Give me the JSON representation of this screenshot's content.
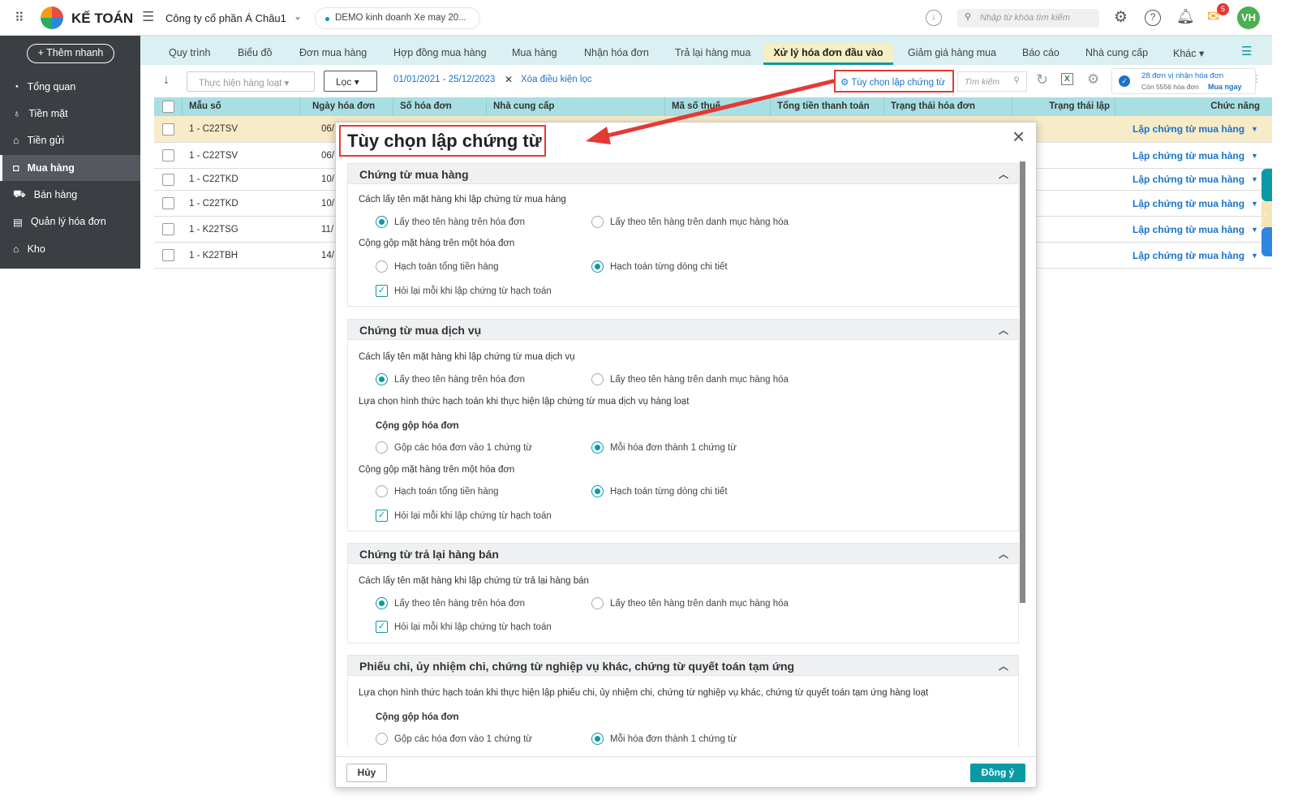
{
  "topbar": {
    "brand": "KẾ TOÁN",
    "company": "Công ty cổ phần Á Châu1",
    "db": "DEMO kinh doanh Xe may 20...",
    "search_placeholder": "Nhập từ khóa tìm kiếm",
    "notif_count": "5",
    "avatar": "VH"
  },
  "sidebar": {
    "quick_add": "+ Thêm nhanh",
    "items": [
      {
        "label": "Tổng quan"
      },
      {
        "label": "Tiền mặt"
      },
      {
        "label": "Tiền gửi"
      },
      {
        "label": "Mua hàng"
      },
      {
        "label": "Bán hàng"
      },
      {
        "label": "Quản lý hóa đơn"
      },
      {
        "label": "Kho"
      }
    ]
  },
  "tabs": [
    "Quy trình",
    "Biểu đồ",
    "Đơn mua hàng",
    "Hợp đồng mua hàng",
    "Mua hàng",
    "Nhận hóa đơn",
    "Trả lại hàng mua",
    "Xử lý hóa đơn đầu vào",
    "Giảm giá hàng mua",
    "Báo cáo",
    "Nhà cung cấp",
    "Khác ▾"
  ],
  "toolbar": {
    "bulk": "Thực hiện hàng loạt",
    "filter": "Lọc",
    "date_range": "01/01/2021 - 25/12/2023",
    "clear_filter": "Xóa điều kiện lọc",
    "options": "Tùy chọn lập chứng từ",
    "search_placeholder": "Tìm kiếm",
    "promo_line1": "28 đơn vị nhận hóa đơn",
    "promo_line2": "Còn 5556 hóa đơn",
    "promo_buy": "Mua ngay"
  },
  "table": {
    "headers": [
      "Mẫu số",
      "Ngày hóa đơn",
      "Số hóa đơn",
      "Nhà cung cấp",
      "Mã số thuế",
      "Tổng tiền thanh toán",
      "Trạng thái hóa đơn",
      "Trạng thái lập",
      "Chức năng"
    ],
    "rows": [
      {
        "mau": "1 - C22TSV",
        "ngay": "06/",
        "action": "Lập chứng từ mua hàng"
      },
      {
        "mau": "1 - C22TSV",
        "ngay": "06/",
        "action": "Lập chứng từ mua hàng"
      },
      {
        "mau": "1 - C22TKD",
        "ngay": "10/",
        "action": "Lập chứng từ mua hàng"
      },
      {
        "mau": "1 - C22TKD",
        "ngay": "10/",
        "action": "Lập chứng từ mua hàng"
      },
      {
        "mau": "1 - K22TSG",
        "ngay": "11/",
        "action": "Lập chứng từ mua hàng"
      },
      {
        "mau": "1 - K22TBH",
        "ngay": "14/",
        "action": "Lập chứng từ mua hàng"
      }
    ]
  },
  "modal": {
    "title": "Tùy chọn lập chứng từ",
    "s1": {
      "title": "Chứng từ mua hàng",
      "l1": "Cách lấy tên mặt hàng khi lập chứng từ mua hàng",
      "o1a": "Lấy theo tên hàng trên hóa đơn",
      "o1b": "Lấy theo tên hàng trên danh mục hàng hóa",
      "l2": "Cộng gộp mặt hàng trên một hóa đơn",
      "o2a": "Hạch toán tổng tiền hàng",
      "o2b": "Hạch toán từng dòng chi tiết",
      "ck": "Hỏi lại mỗi khi lập chứng từ hạch toán"
    },
    "s2": {
      "title": "Chứng từ mua dịch vụ",
      "l1": "Cách lấy tên mặt hàng khi lập chứng từ mua dịch vụ",
      "o1a": "Lấy theo tên hàng trên hóa đơn",
      "o1b": "Lấy theo tên hàng trên danh mục hàng hóa",
      "l2": "Lựa chọn hình thức hạch toán khi thực hiện lập chứng từ mua dịch vụ hàng loạt",
      "l3": "Cộng gộp hóa đơn",
      "o3a": "Gộp các hóa đơn vào 1 chứng từ",
      "o3b": "Mỗi hóa đơn thành 1 chứng từ",
      "l4": "Cộng gộp mặt hàng trên một hóa đơn",
      "o4a": "Hạch toán tổng tiền hàng",
      "o4b": "Hạch toán từng dòng chi tiết",
      "ck": "Hỏi lại mỗi khi lập chứng từ hạch toán"
    },
    "s3": {
      "title": "Chứng từ trả lại hàng bán",
      "l1": "Cách lấy tên mặt hàng khi lập chứng từ trả lại hàng bán",
      "o1a": "Lấy theo tên hàng trên hóa đơn",
      "o1b": "Lấy theo tên hàng trên danh mục hàng hóa",
      "ck": "Hỏi lại mỗi khi lập chứng từ hạch toán"
    },
    "s4": {
      "title": "Phiếu chi, ủy nhiệm chi, chứng từ nghiệp vụ khác, chứng từ quyết toán tạm ứng",
      "l1": "Lựa chọn hình thức hạch toán khi thực hiện lập phiếu chi, ủy nhiệm chi, chứng từ nghiệp vụ khác, chứng từ quyết toán tạm ứng hàng loạt",
      "l2": "Cộng gộp hóa đơn",
      "o2a": "Gộp các hóa đơn vào 1 chứng từ",
      "o2b": "Mỗi hóa đơn thành 1 chứng từ"
    },
    "cancel": "Hủy",
    "ok": "Đồng ý"
  }
}
